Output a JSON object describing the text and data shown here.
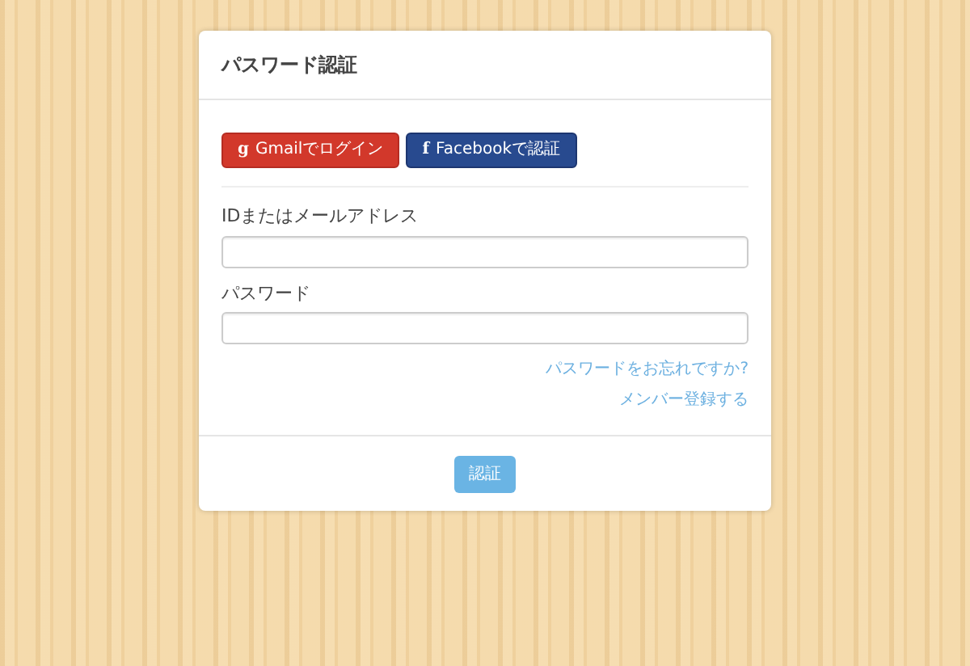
{
  "card": {
    "title": "パスワード認証"
  },
  "social_buttons": [
    {
      "kind": "google",
      "icon": "g",
      "label": "Gmailでログイン"
    },
    {
      "kind": "facebook",
      "icon": "f",
      "label": "Facebookで認証"
    }
  ],
  "fields": [
    {
      "label": "IDまたはメールアドレス"
    },
    {
      "label": "パスワード"
    }
  ],
  "links": [
    "パスワードをお忘れですか?",
    "メンバー登録する"
  ],
  "submit": {
    "label": "認証"
  }
}
